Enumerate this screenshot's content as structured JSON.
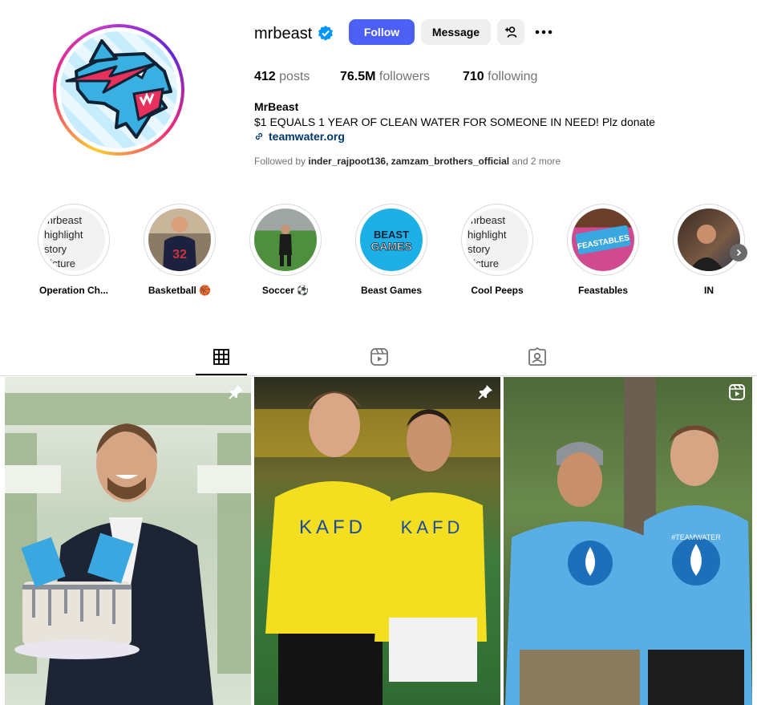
{
  "profile": {
    "username": "mrbeast",
    "full_name": "MrBeast",
    "bio": "$1 EQUALS 1 YEAR OF CLEAN WATER FOR SOMEONE IN NEED! Plz donate",
    "link": "teamwater.org",
    "followed_by_prefix": "Followed by",
    "followed_by_users": "inder_rajpoot136, zamzam_brothers_official",
    "followed_by_suffix": "and 2 more"
  },
  "buttons": {
    "follow": "Follow",
    "message": "Message"
  },
  "stats": {
    "posts_count": "412",
    "posts_label": "posts",
    "followers_count": "76.5M",
    "followers_label": "followers",
    "following_count": "710",
    "following_label": "following"
  },
  "highlights": [
    {
      "label": "Operation Ch...",
      "alt": [
        "mrbeast",
        "highlight",
        "story",
        "picture"
      ]
    },
    {
      "label": "Basketball 🏀",
      "jersey": "32"
    },
    {
      "label": "Soccer ⚽"
    },
    {
      "label": "Beast Games",
      "logo_top": "BEAST",
      "logo_bottom": "GAMES"
    },
    {
      "label": "Cool Peeps",
      "alt": [
        "mrbeast",
        "highlight",
        "story",
        "picture"
      ]
    },
    {
      "label": "Feastables",
      "logo": "FEASTABLES"
    },
    {
      "label": "IN"
    }
  ],
  "icons": {
    "verified": "verified-badge-icon",
    "add_user": "person-add-icon",
    "more": "more-horizontal-icon",
    "link": "link-icon",
    "grid": "grid-icon",
    "reels": "reels-icon",
    "tagged": "tagged-icon",
    "pin": "pin-icon",
    "next": "chevron-right-icon"
  },
  "colors": {
    "follow_button": "#4c60f5",
    "link_text": "#00376b",
    "secondary_text": "#737373"
  },
  "posts": [
    {
      "badge": "pin-icon",
      "subject": "MrBeast holding cake with money background"
    },
    {
      "badge": "pin-icon",
      "subject": "MrBeast and Cristiano Ronaldo in yellow KAFD jerseys",
      "jersey_text": "KAFD"
    },
    {
      "badge": "reels-icon",
      "subject": "MrBeast and friend in blue #TEAMWATER shirts",
      "shirt_text": "#TEAMWATER"
    }
  ]
}
